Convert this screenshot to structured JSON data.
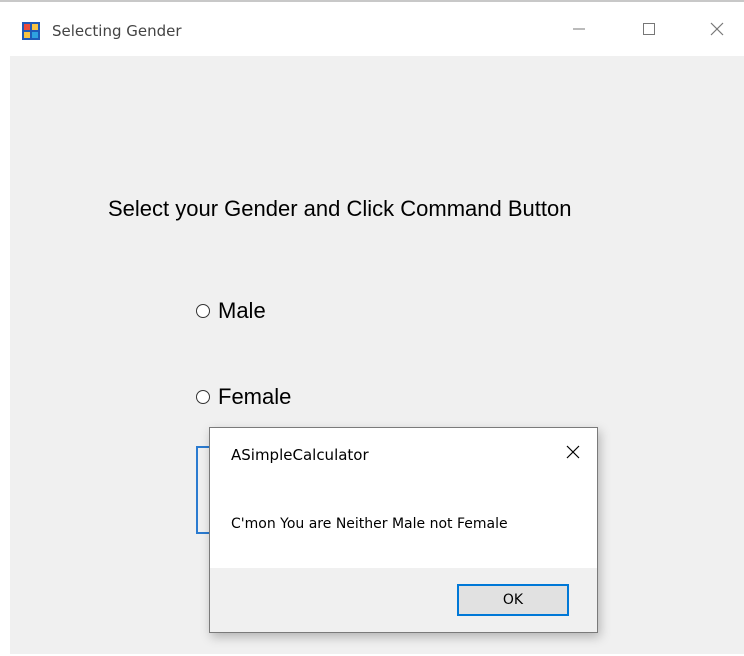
{
  "window": {
    "title": "Selecting Gender",
    "icon": "windows-form-icon"
  },
  "form": {
    "heading": "Select your Gender and Click Command Button",
    "options": [
      {
        "label": "Male",
        "selected": false
      },
      {
        "label": "Female",
        "selected": false
      }
    ]
  },
  "dialog": {
    "title": "ASimpleCalculator",
    "message": "C'mon You are Neither Male not Female",
    "ok_label": "OK"
  },
  "colors": {
    "accent": "#0078d7",
    "window_bg": "#f0f0f0"
  }
}
